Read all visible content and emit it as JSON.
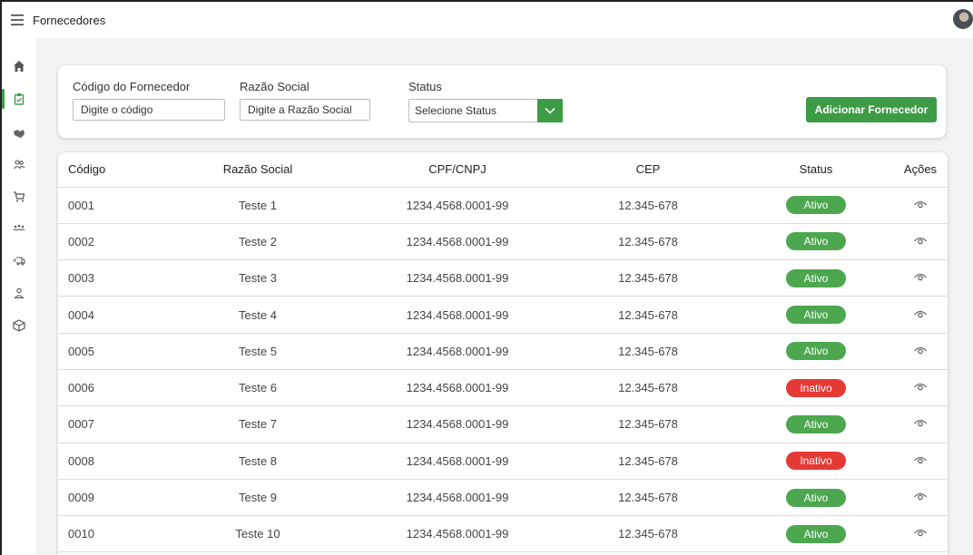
{
  "header": {
    "title": "Fornecedores"
  },
  "colors": {
    "accent": "#3d9b46",
    "active": "#4ca74f",
    "inactive": "#e53935"
  },
  "sidebar": {
    "items": [
      {
        "icon": "home-icon"
      },
      {
        "icon": "clipboard-icon",
        "active": true
      },
      {
        "icon": "handshake-icon"
      },
      {
        "icon": "users-icon"
      },
      {
        "icon": "cart-icon"
      },
      {
        "icon": "team-icon"
      },
      {
        "icon": "truck-icon"
      },
      {
        "icon": "user-icon"
      },
      {
        "icon": "box-icon"
      }
    ]
  },
  "filters": {
    "codigo_label": "Código do Fornecedor",
    "codigo_placeholder": "Digite o código",
    "razao_label": "Razão Social",
    "razao_placeholder": "Digite a Razão Social",
    "status_label": "Status",
    "status_value": "Selecione Status",
    "add_button": "Adicionar Fornecedor"
  },
  "table": {
    "headers": [
      "Código",
      "Razão Social",
      "CPF/CNPJ",
      "CEP",
      "Status",
      "Ações"
    ],
    "rows": [
      [
        "0001",
        "Teste 1",
        "1234.4568.0001-99",
        "12.345-678",
        "Ativo"
      ],
      [
        "0002",
        "Teste 2",
        "1234.4568.0001-99",
        "12.345-678",
        "Ativo"
      ],
      [
        "0003",
        "Teste 3",
        "1234.4568.0001-99",
        "12.345-678",
        "Ativo"
      ],
      [
        "0004",
        "Teste 4",
        "1234.4568.0001-99",
        "12.345-678",
        "Ativo"
      ],
      [
        "0005",
        "Teste 5",
        "1234.4568.0001-99",
        "12.345-678",
        "Ativo"
      ],
      [
        "0006",
        "Teste 6",
        "1234.4568.0001-99",
        "12.345-678",
        "Inativo"
      ],
      [
        "0007",
        "Teste 7",
        "1234.4568.0001-99",
        "12.345-678",
        "Ativo"
      ],
      [
        "0008",
        "Teste 8",
        "1234.4568.0001-99",
        "12.345-678",
        "Inativo"
      ],
      [
        "0009",
        "Teste 9",
        "1234.4568.0001-99",
        "12.345-678",
        "Ativo"
      ],
      [
        "0010",
        "Teste 10",
        "1234.4568.0001-99",
        "12.345-678",
        "Ativo"
      ]
    ]
  }
}
